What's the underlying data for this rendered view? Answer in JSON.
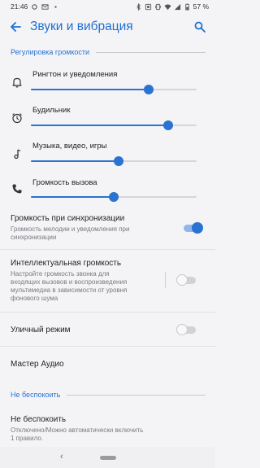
{
  "status_bar": {
    "time": "21:46",
    "battery": "57 %"
  },
  "app_bar": {
    "title": "Звуки и вибрация",
    "back_icon": "arrow-back-icon",
    "search_icon": "search-icon"
  },
  "volume_section": {
    "header": "Регулировка громкости",
    "sliders": [
      {
        "label": "Рингтон и уведомления",
        "icon": "bell-icon",
        "level": 0.71
      },
      {
        "label": "Будильник",
        "icon": "alarm-icon",
        "level": 0.83
      },
      {
        "label": "Музыка, видео, игры",
        "icon": "music-note-icon",
        "level": 0.53
      },
      {
        "label": "Громкость вызова",
        "icon": "phone-icon",
        "level": 0.5
      }
    ]
  },
  "prefs": {
    "sync": {
      "title": "Громкость при синхронизации",
      "subtitle_line1": "Громкость мелодии и уведомления при",
      "subtitle_line2": "синхронизации",
      "on": true
    },
    "smart": {
      "title": "Интеллектуальная громкость",
      "subtitle_line1": "Настройте громкость звонка для",
      "subtitle_line2": "входящих вызовов и воспроизведения",
      "subtitle_line3": "мультимедиа в зависимости от уровня",
      "subtitle_line4": "фонового шума",
      "on": false
    },
    "street": {
      "title": "Уличный режим",
      "on": false
    },
    "audio_wizard": {
      "title": "Мастер Аудио"
    }
  },
  "dnd_section": {
    "header": "Не беспокоить",
    "item_title": "Не беспокоить",
    "item_sub_line1": "Отключено/Можно автоматически включить",
    "item_sub_line2": "1 правило."
  },
  "colors": {
    "accent": "#2a73d0",
    "title": "#1e6fd0"
  }
}
